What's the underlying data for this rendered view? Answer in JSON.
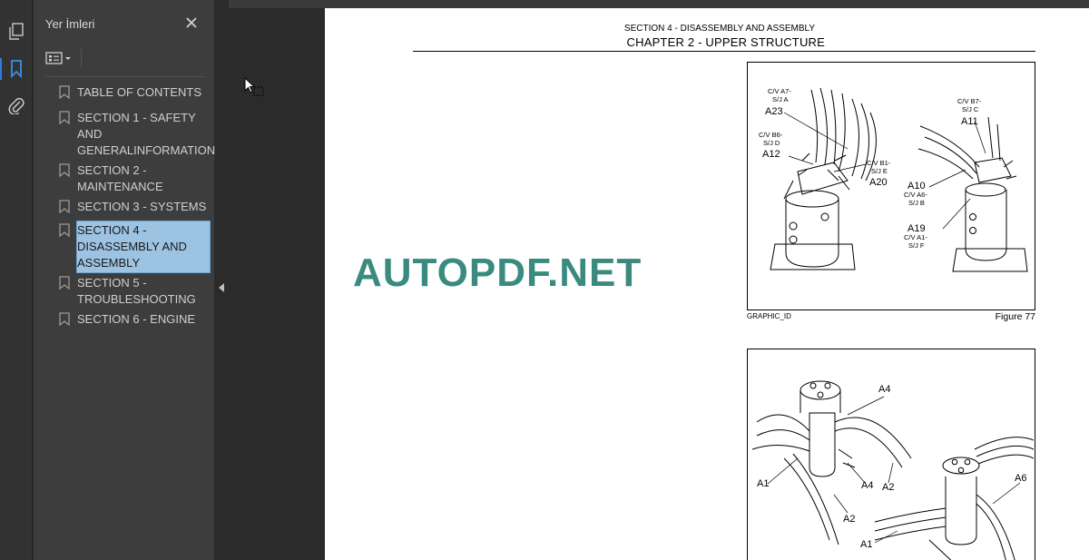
{
  "sidebar": {
    "panel_title": "Yer İmleri",
    "bookmarks": [
      {
        "label": "TABLE OF CONTENTS"
      },
      {
        "label": "SECTION 1 - SAFETY AND GENERALINFORMATION"
      },
      {
        "label": "SECTION 2 - MAINTENANCE"
      },
      {
        "label": "SECTION 3 - SYSTEMS"
      },
      {
        "label": "SECTION 4 - DISASSEMBLY AND ASSEMBLY"
      },
      {
        "label": "SECTION 5 - TROUBLESHOOTING"
      },
      {
        "label": "SECTION 6 - ENGINE"
      }
    ],
    "selected_index": 4
  },
  "rail": {
    "icons": [
      "pages-icon",
      "bookmark-icon",
      "attachment-icon"
    ],
    "active": "bookmark-icon"
  },
  "page": {
    "section_header": "SECTION 4 - DISASSEMBLY AND ASSEMBLY",
    "chapter_header": "CHAPTER 2 - UPPER STRUCTURE",
    "watermark": "AUTOPDF.NET",
    "figure1": {
      "caption_id": "GRAPHIC_ID",
      "caption": "Figure 77",
      "labels": {
        "a23_desc1": "C/V A7-",
        "a23_desc2": "S/J A",
        "a23": "A23",
        "a12_desc1": "C/V B6-",
        "a12_desc2": "S/J D",
        "a12": "A12",
        "a20_desc1": "C/V B1-",
        "a20_desc2": "S/J E",
        "a20": "A20",
        "a11_desc1": "C/V B7-",
        "a11_desc2": "S/J C",
        "a11": "A11",
        "a10": "A10",
        "a10_desc1": "C/V A6-",
        "a10_desc2": "S/J B",
        "a19": "A19",
        "a19_desc1": "C/V A1-",
        "a19_desc2": "S/J F"
      }
    },
    "figure2": {
      "labels": {
        "a4_top": "A4",
        "a4_mid": "A4",
        "a1_left": "A1",
        "a2_mid": "A2",
        "a2_bottom": "A2",
        "a6": "A6",
        "a1_bottom": "A1"
      }
    }
  },
  "colors": {
    "accent": "#2f7ddb",
    "selection": "#9dc3e3",
    "watermark": "#3a8a7f",
    "panel_bg": "#3d3d3d"
  }
}
